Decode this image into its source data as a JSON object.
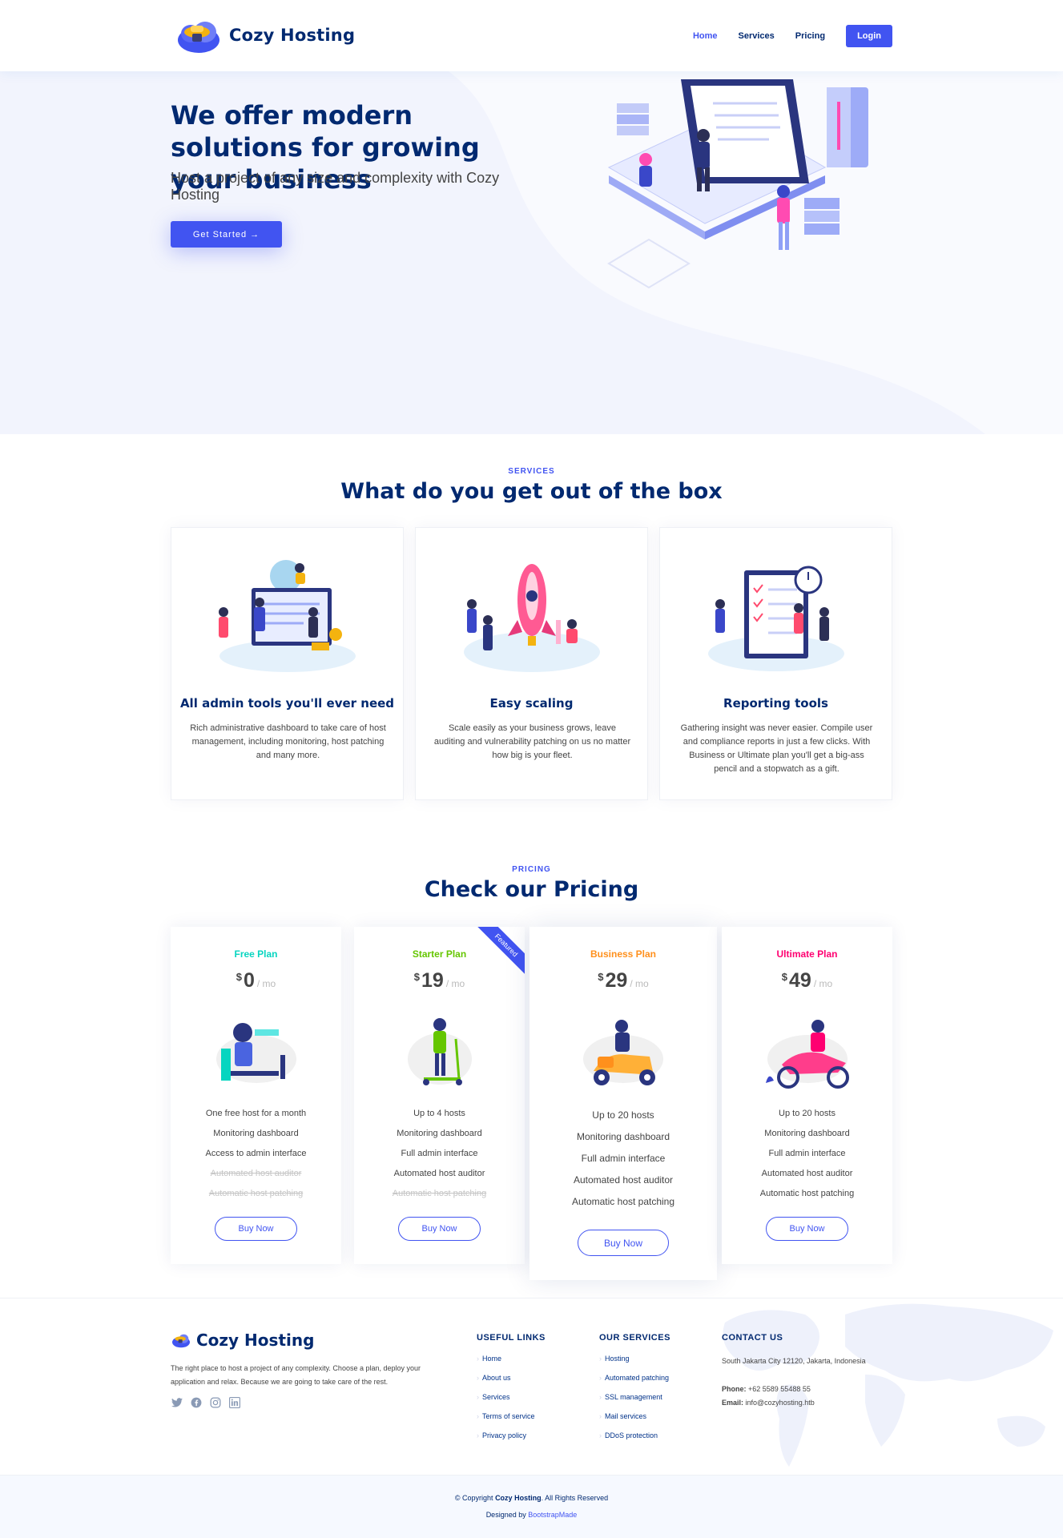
{
  "header": {
    "brand": "Cozy Hosting",
    "nav": [
      {
        "label": "Home"
      },
      {
        "label": "Services"
      },
      {
        "label": "Pricing"
      }
    ],
    "login_label": "Login"
  },
  "hero": {
    "title": "We offer modern solutions for growing your business",
    "subtitle": "Host a project of any size and complexity with Cozy Hosting",
    "cta_label": "Get Started"
  },
  "services": {
    "tag": "SERVICES",
    "title": "What do you get out of the box",
    "cards": [
      {
        "title": "All admin tools you'll ever need",
        "description": "Rich administrative dashboard to take care of host management, including monitoring, host patching and many more."
      },
      {
        "title": "Easy scaling",
        "description": "Scale easily as your business grows, leave auditing and vulnerability patching on us no matter how big is your fleet."
      },
      {
        "title": "Reporting tools",
        "description": "Gathering insight was never easier. Compile user and compliance reports in just a few clicks. With Business or Ultimate plan you'll get a big-ass pencil and a stopwatch as a gift."
      }
    ]
  },
  "pricing": {
    "tag": "PRICING",
    "title": "Check our Pricing",
    "currency": "$",
    "period": "/ mo",
    "ribbon": "Featured",
    "buy_label": "Buy Now",
    "plans": [
      {
        "name": "Free Plan",
        "color": "#07d5c0",
        "price": "0",
        "features": [
          "One free host for a month",
          "Monitoring dashboard",
          "Access to admin interface",
          "Automated host auditor",
          "Automatic host patching"
        ]
      },
      {
        "name": "Starter Plan",
        "color": "#65c600",
        "price": "19",
        "features": [
          "Up to 4 hosts",
          "Monitoring dashboard",
          "Full admin interface",
          "Automated host auditor",
          "Automatic host patching"
        ]
      },
      {
        "name": "Business Plan",
        "color": "#ff901c",
        "price": "29",
        "features": [
          "Up to 20 hosts",
          "Monitoring dashboard",
          "Full admin interface",
          "Automated host auditor",
          "Automatic host patching"
        ]
      },
      {
        "name": "Ultimate Plan",
        "color": "#ff0071",
        "price": "49",
        "features": [
          "Up to 20 hosts",
          "Monitoring dashboard",
          "Full admin interface",
          "Automated host auditor",
          "Automatic host patching"
        ]
      }
    ]
  },
  "footer": {
    "brand": "Cozy Hosting",
    "description": "The right place to host a project of any complexity. Choose a plan, deploy your application and relax. Because we are going to take care of the rest.",
    "social": [
      "twitter-icon",
      "facebook-icon",
      "instagram-icon",
      "linkedin-icon"
    ],
    "useful_links": {
      "heading": "USEFUL LINKS",
      "items": [
        "Home",
        "About us",
        "Services",
        "Terms of service",
        "Privacy policy"
      ]
    },
    "our_services": {
      "heading": "OUR SERVICES",
      "items": [
        "Hosting",
        "Automated patching",
        "SSL management",
        "Mail services",
        "DDoS protection"
      ]
    },
    "contact": {
      "heading": "CONTACT US",
      "address": "South Jakarta City 12120, Jakarta, Indonesia",
      "phone_label": "Phone:",
      "phone": "+62 5589 55488 55",
      "email_label": "Email:",
      "email": "info@cozyhosting.htb"
    },
    "copyright_prefix": "© Copyright",
    "copyright_brand": "Cozy Hosting",
    "copyright_suffix": ". All Rights Reserved",
    "designed_by_prefix": "Designed by",
    "designed_by": "BootstrapMade"
  },
  "colors": {
    "accent": "#4154f1",
    "navy": "#012970"
  }
}
